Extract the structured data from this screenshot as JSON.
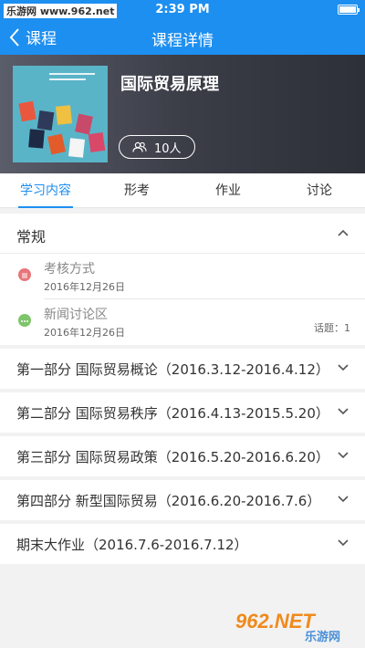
{
  "status": {
    "watermark": "乐游网 www.962.net",
    "time": "2:39 PM"
  },
  "nav": {
    "back_label": "课程",
    "title": "课程详情"
  },
  "course": {
    "title": "国际贸易原理",
    "people": "10人"
  },
  "tabs": [
    "学习内容",
    "形考",
    "作业",
    "讨论"
  ],
  "general": {
    "label": "常规",
    "items": [
      {
        "name": "考核方式",
        "date": "2016年12月26日",
        "extra": ""
      },
      {
        "name": "新闻讨论区",
        "date": "2016年12月26日",
        "extra": "话题：1"
      }
    ]
  },
  "parts": [
    "第一部分  国际贸易概论（2016.3.12-2016.4.12）",
    "第二部分 国际贸易秩序（2016.4.13-2015.5.20）",
    "第三部分 国际贸易政策（2016.5.20-2016.6.20）",
    "第四部分 新型国际贸易（2016.6.20-2016.7.6）",
    "期末大作业（2016.7.6-2016.7.12）"
  ],
  "bottom_watermark": {
    "brand": "962.NET",
    "sub": "乐游网"
  },
  "colors": {
    "primary": "#1d8ff0",
    "dot_red": "#e8757a",
    "dot_green": "#7ec46a"
  }
}
